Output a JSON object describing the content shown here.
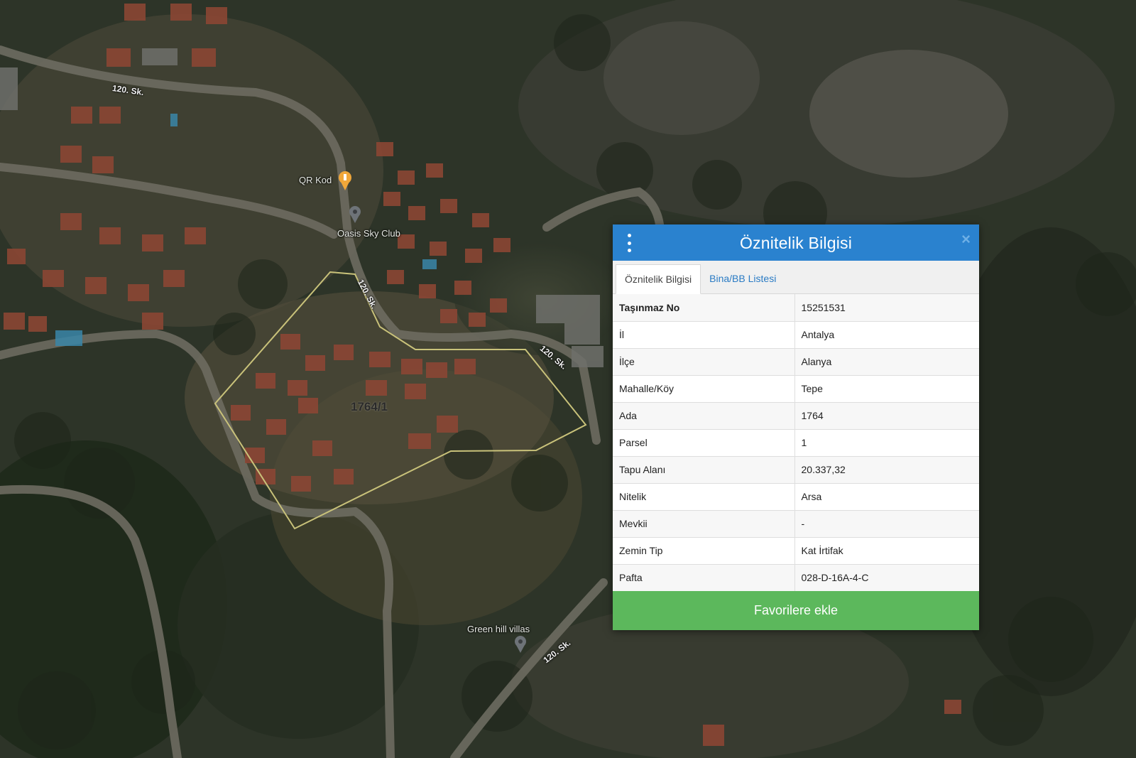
{
  "map": {
    "labels": {
      "road_120_a": "120. Sk.",
      "road_120_b": "120. Sk.",
      "road_120_c": "120. Sk.",
      "road_120_d": "120. Sk.",
      "qr_kod": "QR Kod",
      "oasis": "Oasis Sky Club",
      "green_hill": "Green hill villas",
      "parcel": "1764/1"
    },
    "colors": {
      "parcel_outline": "#c9c27a",
      "pin": "#f0a73a"
    }
  },
  "popup": {
    "title": "Öznitelik Bilgisi",
    "menu_icon": "vertical-ellipsis-icon",
    "close_icon": "close-icon",
    "close_glyph": "×",
    "tabs": [
      {
        "label": "Öznitelik Bilgisi",
        "active": true
      },
      {
        "label": "Bina/BB Listesi",
        "active": false
      }
    ],
    "rows": [
      {
        "key": "Taşınmaz No",
        "value": "15251531"
      },
      {
        "key": "İl",
        "value": "Antalya"
      },
      {
        "key": "İlçe",
        "value": "Alanya"
      },
      {
        "key": "Mahalle/Köy",
        "value": "Tepe"
      },
      {
        "key": "Ada",
        "value": "1764"
      },
      {
        "key": "Parsel",
        "value": "1"
      },
      {
        "key": "Tapu Alanı",
        "value": "20.337,32"
      },
      {
        "key": "Nitelik",
        "value": "Arsa"
      },
      {
        "key": "Mevkii",
        "value": "-"
      },
      {
        "key": "Zemin Tip",
        "value": "Kat İrtifak"
      },
      {
        "key": "Pafta",
        "value": "028-D-16A-4-C"
      }
    ],
    "favorite_button": "Favorilere ekle",
    "colors": {
      "header": "#2a82cf",
      "button": "#5cb85c",
      "tab_link": "#2a7bc4"
    }
  }
}
